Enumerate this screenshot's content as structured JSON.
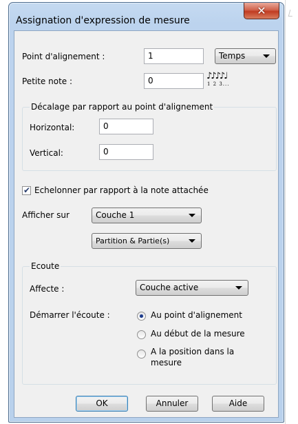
{
  "window": {
    "title": "Assignation d'expression de mesure",
    "close_icon": "close-icon"
  },
  "alignment_point": {
    "label": "Point d'alignement :",
    "value": "1",
    "unit_select": "Temps"
  },
  "grace_note": {
    "label": "Petite note :",
    "value": "0",
    "icon": "grace-notes-icon",
    "icon_glyph": "♪♪♪♪♩",
    "icon_numbers": "1 2 3..."
  },
  "offset_group": {
    "title": "Décalage par rapport au point d'alignement",
    "horizontal_label": "Horizontal:",
    "horizontal_value": "0",
    "vertical_label": "Vertical:",
    "vertical_value": "0"
  },
  "scale_checkbox": {
    "label": "Echelonner par rapport à la note attachée",
    "checked": true
  },
  "display": {
    "label": "Afficher sur",
    "layer_select": "Couche 1",
    "parts_select": "Partition & Partie(s)"
  },
  "playback_group": {
    "title": "Ecoute",
    "affects_label": "Affecte :",
    "affects_select": "Couche active",
    "start_label": "Démarrer l'écoute :",
    "options": [
      {
        "label": "Au point d'alignement",
        "selected": true
      },
      {
        "label": "Au début de la mesure",
        "selected": false
      },
      {
        "label": "A la position dans la",
        "label2": "mesure",
        "selected": false
      }
    ]
  },
  "buttons": {
    "ok": "OK",
    "cancel": "Annuler",
    "help": "Aide"
  }
}
